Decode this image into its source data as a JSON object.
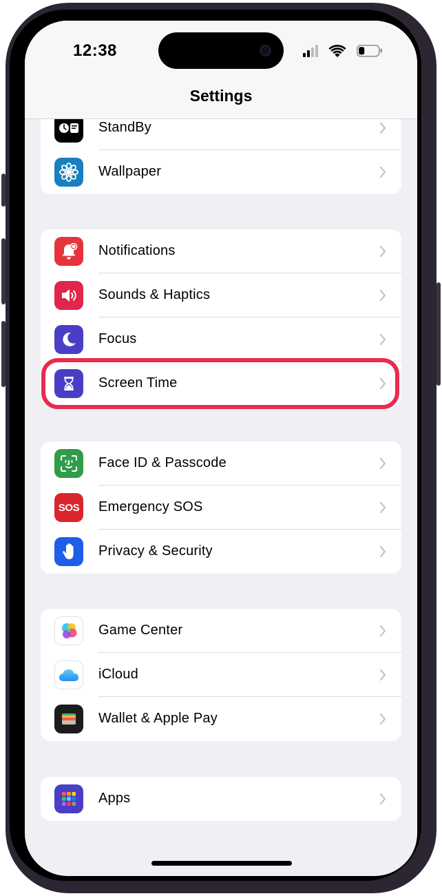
{
  "status_bar": {
    "time": "12:38"
  },
  "nav": {
    "title": "Settings"
  },
  "groups": [
    {
      "rows": [
        {
          "label": "StandBy",
          "icon": "standby-icon"
        },
        {
          "label": "Wallpaper",
          "icon": "wallpaper-icon"
        }
      ]
    },
    {
      "rows": [
        {
          "label": "Notifications",
          "icon": "notifications-icon"
        },
        {
          "label": "Sounds & Haptics",
          "icon": "speaker-icon"
        },
        {
          "label": "Focus",
          "icon": "moon-icon"
        },
        {
          "label": "Screen Time",
          "icon": "hourglass-icon"
        }
      ]
    },
    {
      "rows": [
        {
          "label": "Face ID & Passcode",
          "icon": "face-id-icon"
        },
        {
          "label": "Emergency SOS",
          "icon": "sos-icon",
          "icon_text": "SOS"
        },
        {
          "label": "Privacy & Security",
          "icon": "hand-icon"
        }
      ]
    },
    {
      "rows": [
        {
          "label": "Game Center",
          "icon": "game-center-icon"
        },
        {
          "label": "iCloud",
          "icon": "icloud-icon"
        },
        {
          "label": "Wallet & Apple Pay",
          "icon": "wallet-icon"
        }
      ]
    },
    {
      "rows": [
        {
          "label": "Apps",
          "icon": "apps-grid-icon"
        }
      ]
    }
  ],
  "highlight": {
    "target": "Screen Time",
    "color": "#ea2a4e"
  },
  "colors": {
    "background": "#efeff4",
    "chevron": "#c4c4c7",
    "notifications": "#e5343d",
    "sounds": "#e0264a",
    "focus": "#4b3ec6",
    "screen_time": "#4b3ec6",
    "face_id": "#2f9d4a",
    "sos": "#d9262d",
    "privacy": "#1e5ee8",
    "wallpaper": "#1a7fbf"
  }
}
